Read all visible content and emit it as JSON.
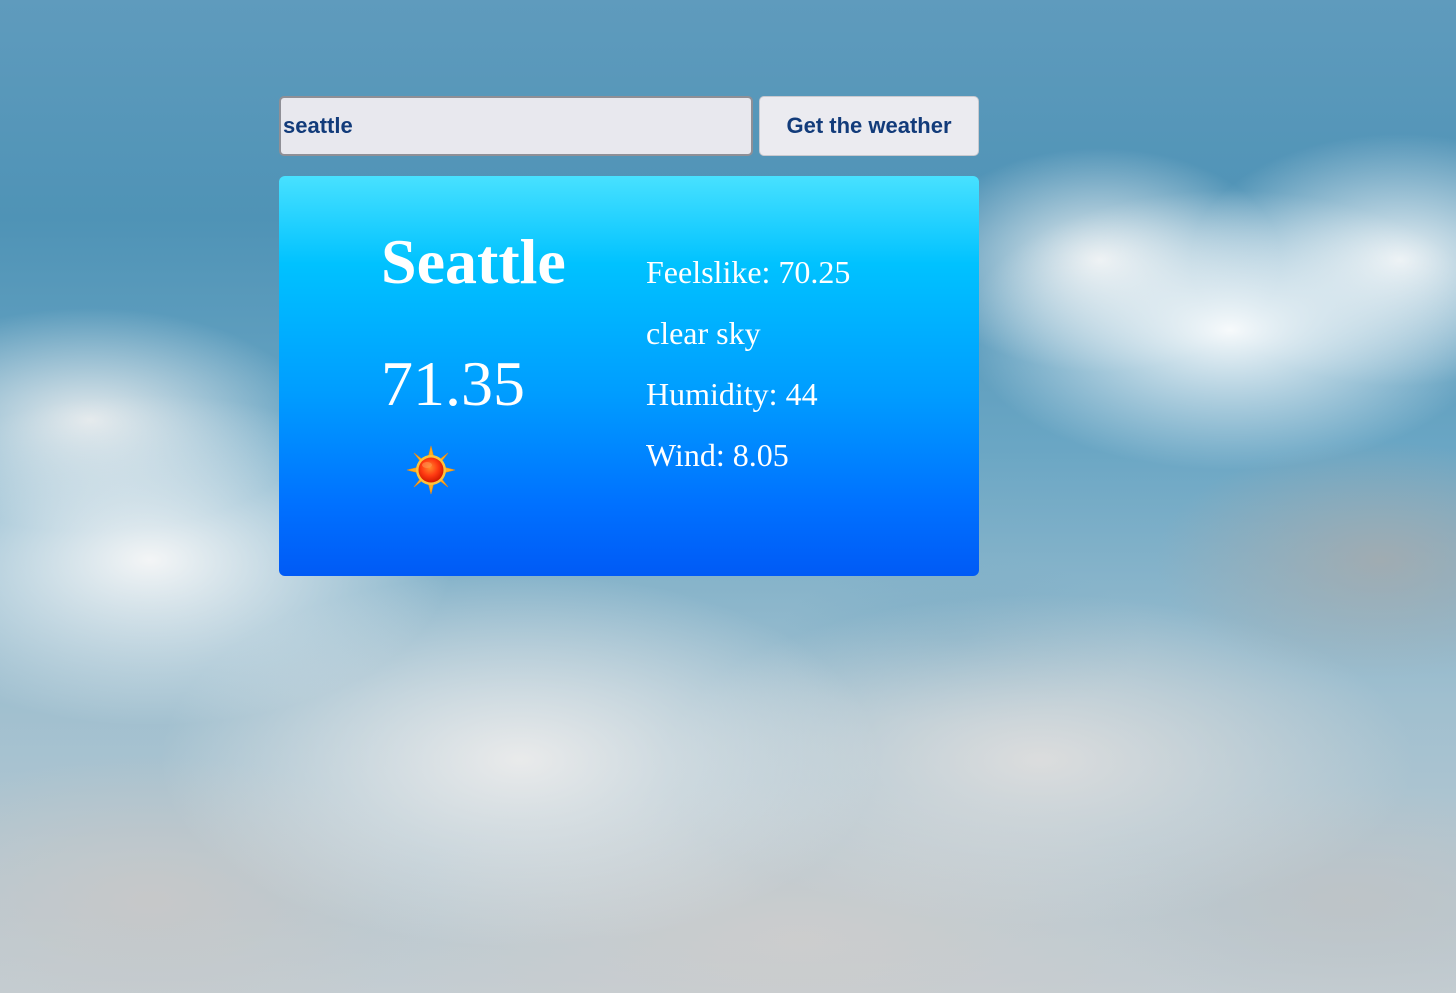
{
  "search": {
    "value": "seattle",
    "button_label": "Get the weather"
  },
  "weather": {
    "city": "Seattle",
    "temperature": "71.35",
    "icon": "sun-icon",
    "feelslike": "Feelslike: 70.25",
    "description": "clear sky",
    "humidity": "Humidity: 44",
    "wind": "Wind: 8.05"
  },
  "colors": {
    "card_top": "#48e1ff",
    "card_bottom": "#005af6",
    "button_text": "#123b7a",
    "input_background": "#e8e8ee"
  }
}
